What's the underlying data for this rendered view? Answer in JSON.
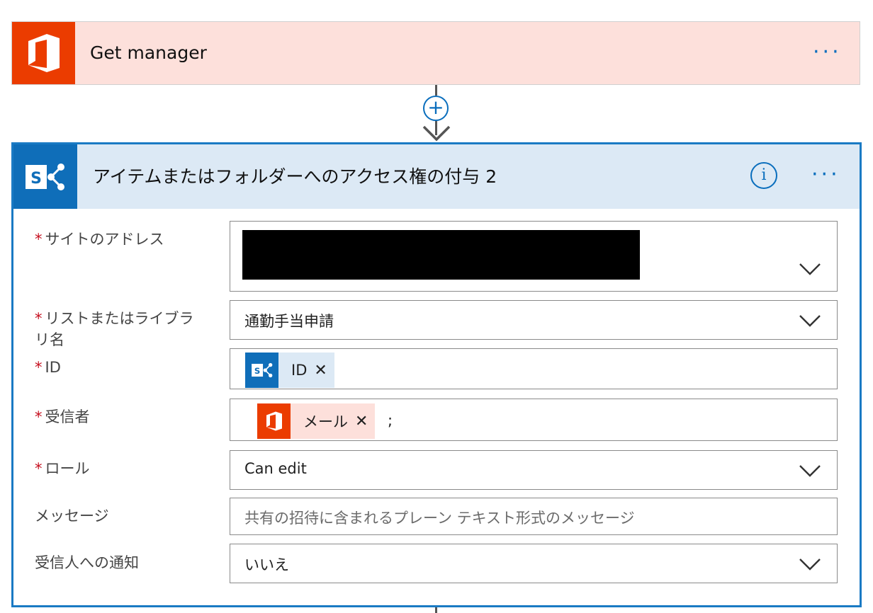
{
  "top_card": {
    "title": "Get manager",
    "more": "···"
  },
  "connector": {
    "add_symbol": "+"
  },
  "main_card": {
    "title": "アイテムまたはフォルダーへのアクセス権の付与 2",
    "info": "i",
    "more": "···"
  },
  "form": {
    "required_mark": "*",
    "site_label": "サイトのアドレス",
    "list_label": "リストまたはライブラリ名",
    "list_value": "通勤手当申請",
    "id_label": "ID",
    "id_token": "ID",
    "recipient_label": "受信者",
    "recipient_token": "メール",
    "recipient_suffix": ";",
    "role_label": "ロール",
    "role_value": "Can edit",
    "message_label": "メッセージ",
    "message_placeholder": "共有の招待に含まれるプレーン テキスト形式のメッセージ",
    "notify_label": "受信人への通知",
    "notify_value": "いいえ",
    "token_close": "✕"
  },
  "colors": {
    "office_orange": "#eb3c00",
    "sharepoint_blue": "#0f6eb9",
    "accent_blue": "#0a6ebd",
    "required_red": "#c50f1f"
  }
}
